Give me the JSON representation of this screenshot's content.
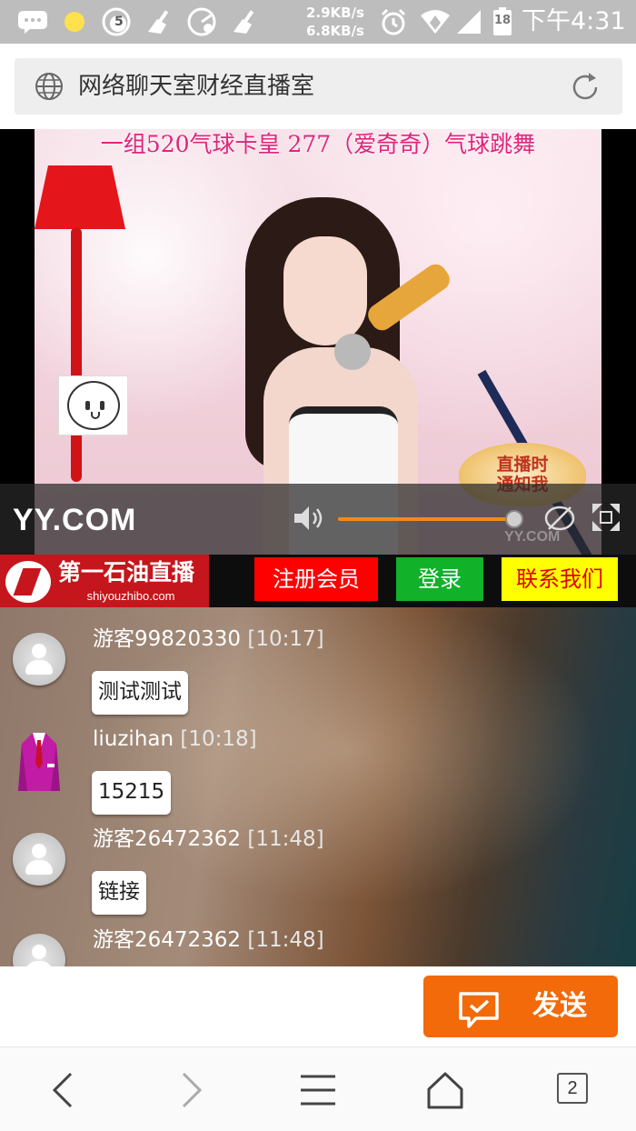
{
  "status_bar": {
    "net_up": "2.9KB/s",
    "net_down": "6.8KB/s",
    "badge_5": "5",
    "battery": "18",
    "time": "下午4:31"
  },
  "browser": {
    "page_title": "网络聊天室财经直播室"
  },
  "video": {
    "marquee": "一组520气球卡皇 277（爱奇奇）气球跳舞",
    "live_badge_line1": "直播时",
    "live_badge_line2": "通知我",
    "logo": "YY.COM",
    "watermark": "YY.COM",
    "volume_fraction": 0.96
  },
  "nav": {
    "brand_name": "第一石油直播",
    "brand_domain": "shiyouzhibo.com",
    "register": "注册会员",
    "login": "登录",
    "contact": "联系我们"
  },
  "chat": {
    "messages": [
      {
        "user": "游客99820330",
        "time": "[10:17]",
        "text": "测试测试",
        "avatar": "default-avatar"
      },
      {
        "user": "liuzihan",
        "time": "[10:18]",
        "text": "15215",
        "avatar": "suit-avatar"
      },
      {
        "user": "游客26472362",
        "time": "[11:48]",
        "text": "链接",
        "avatar": "default-avatar"
      },
      {
        "user": "游客26472362",
        "time": "[11:48]",
        "text": "",
        "avatar": "default-avatar"
      }
    ]
  },
  "input": {
    "placeholder": "",
    "send_label": "发送"
  },
  "bottom_nav": {
    "tab_count": "2"
  },
  "colors": {
    "brand_red": "#c4161c",
    "register_bg": "#ff0000",
    "login_bg": "#11b12a",
    "contact_bg": "#ffff00",
    "send_bg": "#f26a0a",
    "volume_fill": "#f08a1c"
  }
}
